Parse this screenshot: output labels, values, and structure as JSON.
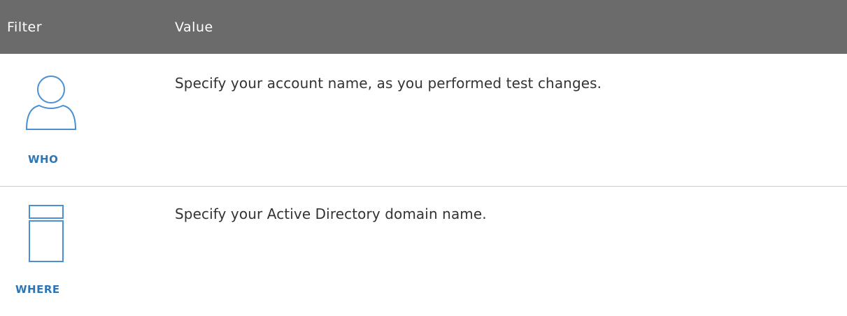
{
  "header": {
    "filter_label": "Filter",
    "value_label": "Value"
  },
  "rows": [
    {
      "filter": "WHO",
      "icon": "user-icon",
      "value": "Specify your  account name, as you performed test changes."
    },
    {
      "filter": "WHERE",
      "icon": "server-icon",
      "value": "Specify your Active Directory domain name."
    }
  ],
  "colors": {
    "header_bg": "#6b6b6b",
    "accent": "#2e75b6"
  }
}
